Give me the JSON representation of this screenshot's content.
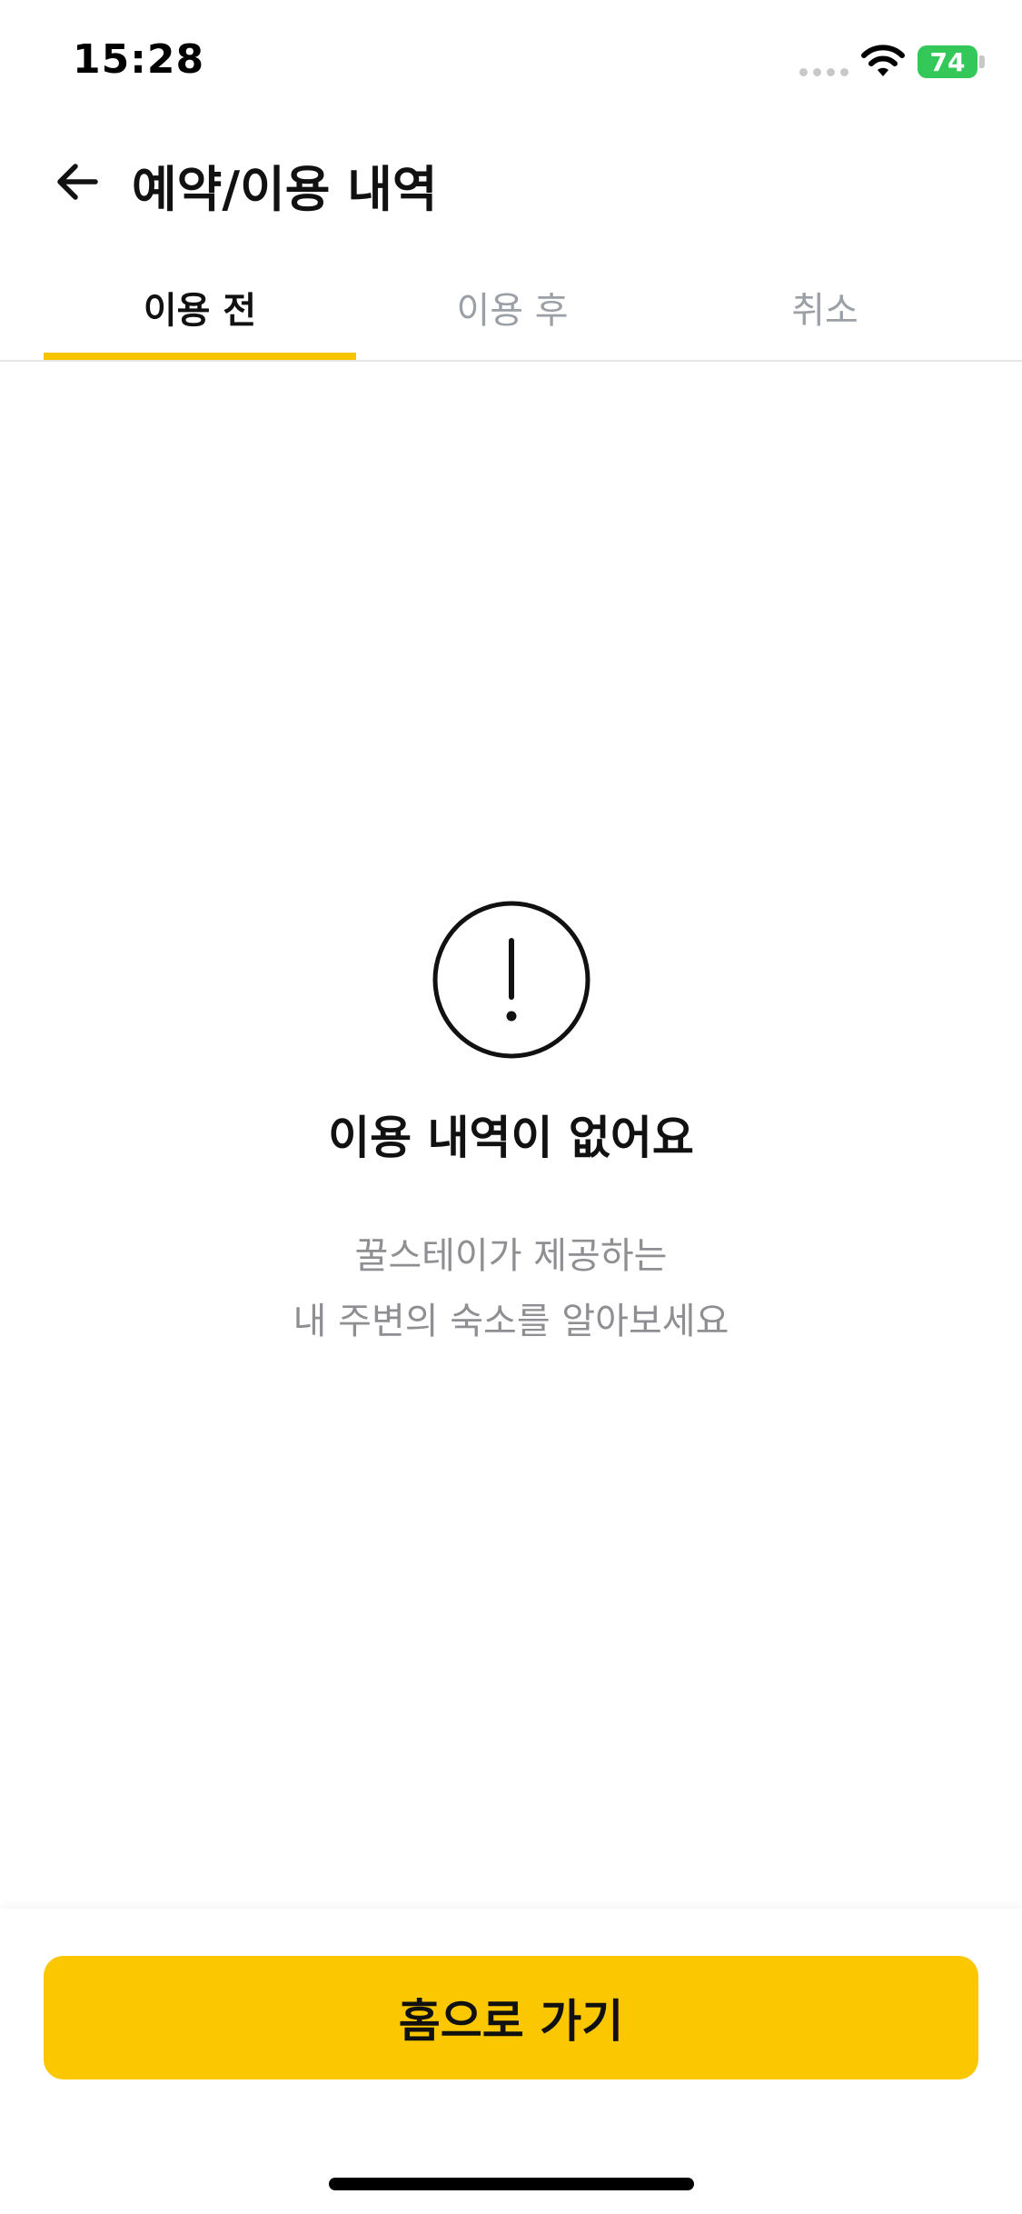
{
  "status_bar": {
    "time": "15:28",
    "battery": "74"
  },
  "header": {
    "back_icon": "arrow-left-icon",
    "title": "예약/이용 내역"
  },
  "tabs": [
    {
      "label": "이용 전",
      "active": true
    },
    {
      "label": "이용 후",
      "active": false
    },
    {
      "label": "취소",
      "active": false
    }
  ],
  "empty_state": {
    "icon": "exclamation-circle-icon",
    "title": "이용 내역이 없어요",
    "desc_line1": "꿀스테이가 제공하는",
    "desc_line2": "내 주변의 숙소를 알아보세요"
  },
  "bottom": {
    "home_button_label": "홈으로 가기"
  },
  "colors": {
    "accent": "#fbc700",
    "tab_indicator": "#f6c500",
    "battery": "#34c759",
    "muted_text": "#8e8e93"
  }
}
